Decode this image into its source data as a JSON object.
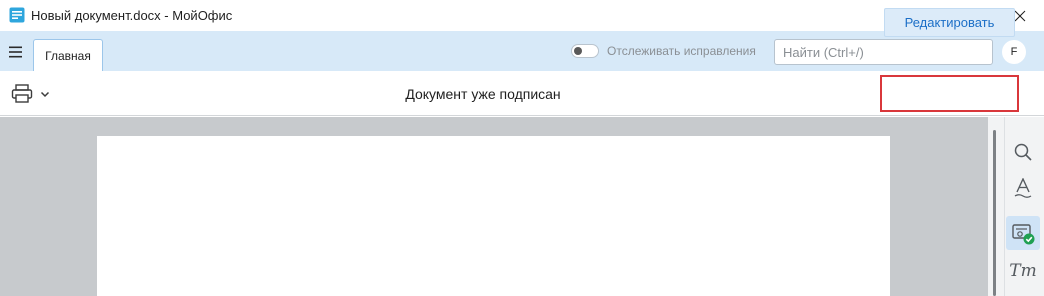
{
  "window": {
    "title": "Новый документ.docx - МойОфис",
    "controls": [
      "minimize-icon",
      "maximize-icon",
      "close-icon"
    ]
  },
  "ribbon": {
    "menu_icon": "hamburger-icon",
    "tabs": [
      {
        "label": "Главная",
        "active": true
      }
    ],
    "track_changes": {
      "label": "Отслеживать исправления",
      "enabled": false
    },
    "search": {
      "placeholder": "Найти (Ctrl+/)",
      "value": ""
    },
    "user": {
      "initial": "F"
    }
  },
  "infobar": {
    "print_icon": "printer-icon",
    "status_text": "Документ уже подписан",
    "edit_label": "Редактировать"
  },
  "sidepanel": {
    "items": [
      {
        "name": "search-icon",
        "active": false
      },
      {
        "name": "text-style-icon",
        "active": false
      },
      {
        "name": "signature-certificate-icon",
        "active": true
      },
      {
        "name": "paragraph-styles-icon",
        "label": "Tт",
        "active": false
      }
    ]
  },
  "colors": {
    "ribbon_bg": "#d7e9f8",
    "accent": "#1c6fc7",
    "highlight_frame": "#d9373b",
    "workspace_bg": "#c7cacd",
    "badge_green": "#1fa052"
  }
}
